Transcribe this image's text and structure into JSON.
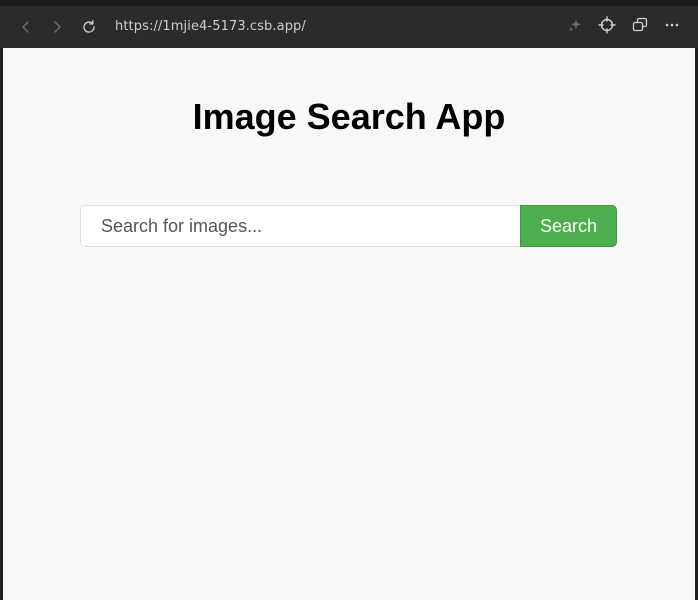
{
  "browser": {
    "url": "https://1mjie4-5173.csb.app/",
    "back_icon": "chevron-left-icon",
    "forward_icon": "chevron-right-icon",
    "reload_icon": "reload-icon",
    "sparkle_icon": "sparkle-icon",
    "crosshair_icon": "crosshair-icon",
    "window_icon": "window-icon",
    "more_icon": "more-icon"
  },
  "page": {
    "title": "Image Search App",
    "search": {
      "placeholder": "Search for images...",
      "value": "",
      "button_label": "Search"
    }
  },
  "colors": {
    "page_background": "#f8f8f8",
    "browser_bar": "#2b2b2b",
    "search_button": "#4cae4c"
  }
}
